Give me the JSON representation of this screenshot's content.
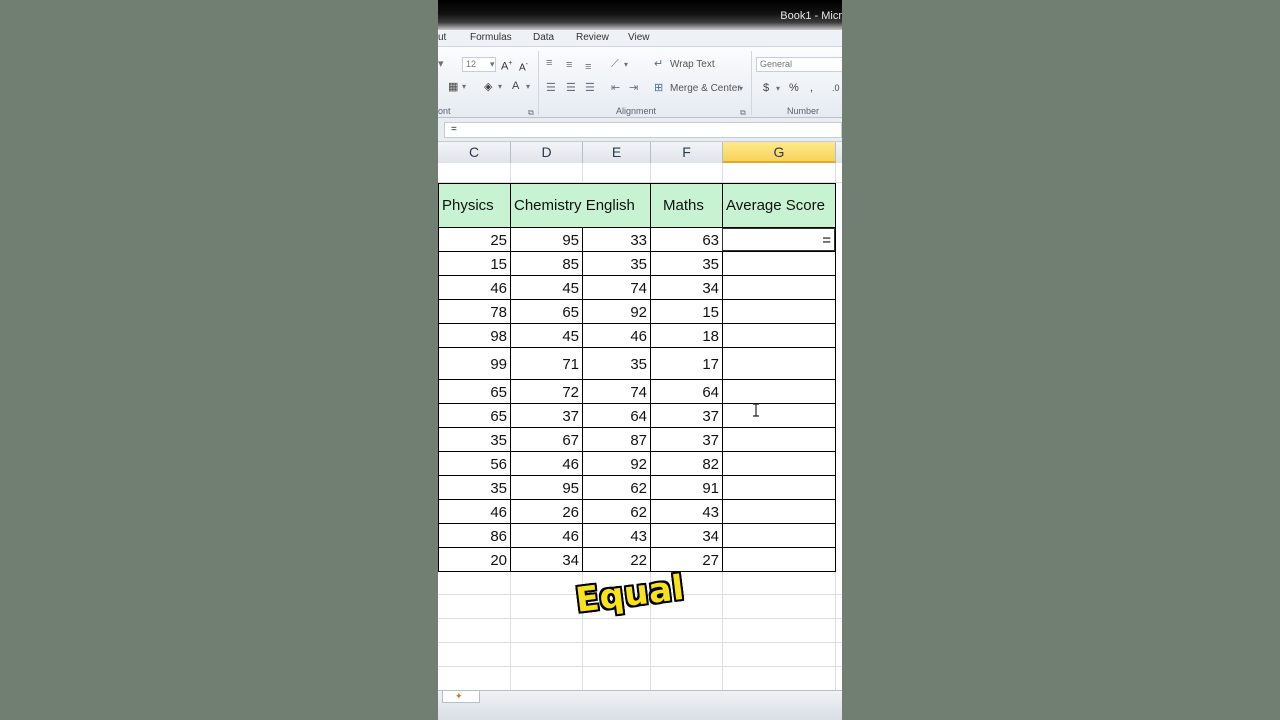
{
  "window": {
    "title": "Book1 - Micr"
  },
  "menu_tabs": [
    "ut",
    "Formulas",
    "Data",
    "Review",
    "View"
  ],
  "ribbon": {
    "font_size": "12",
    "wrap_text_label": "Wrap Text",
    "merge_center_label": "Merge & Center",
    "number_format": "General",
    "groups": {
      "font": "ont",
      "alignment": "Alignment",
      "number": "Number"
    }
  },
  "formula_bar": {
    "value": "="
  },
  "columns": [
    "C",
    "D",
    "E",
    "F",
    "G"
  ],
  "selected_column": "G",
  "table": {
    "headers": [
      "Physics",
      "Chemistry",
      "English",
      "Maths",
      "Average Score"
    ],
    "rows": [
      [
        25,
        95,
        33,
        63
      ],
      [
        15,
        85,
        35,
        35
      ],
      [
        46,
        45,
        74,
        34
      ],
      [
        78,
        65,
        92,
        15
      ],
      [
        98,
        45,
        46,
        18
      ],
      [
        99,
        71,
        35,
        17
      ],
      [
        65,
        72,
        74,
        64
      ],
      [
        65,
        37,
        64,
        37
      ],
      [
        35,
        67,
        87,
        37
      ],
      [
        56,
        46,
        92,
        82
      ],
      [
        35,
        95,
        62,
        91
      ],
      [
        46,
        26,
        62,
        43
      ],
      [
        86,
        46,
        43,
        34
      ],
      [
        20,
        34,
        22,
        27
      ]
    ],
    "active_cell_value": "="
  },
  "overlay_caption": "Equal",
  "colors": {
    "header_fill": "#c7f3d2",
    "selected_column": "#f6d35b",
    "caption": "#f8e21b"
  }
}
